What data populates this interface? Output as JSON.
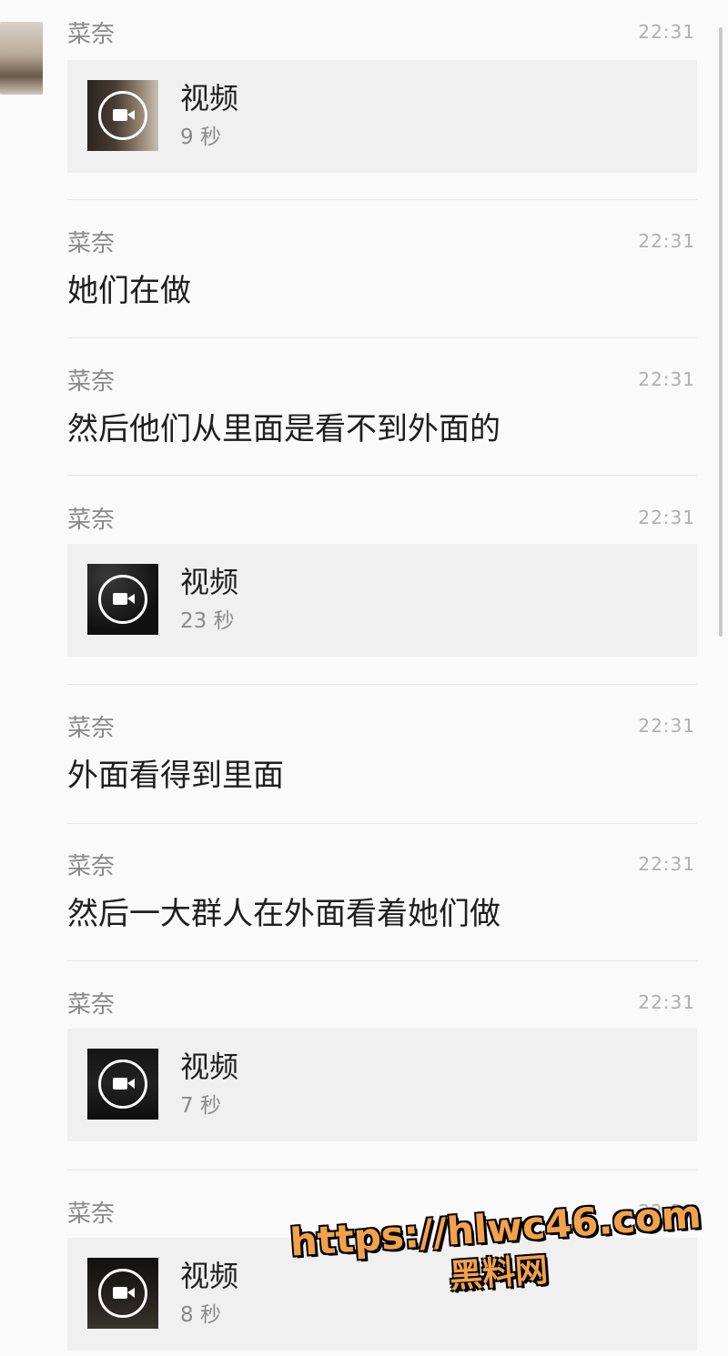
{
  "messages": [
    {
      "type": "video",
      "sender": "菜奈",
      "time": "22:31",
      "title": "视频",
      "duration": "9 秒"
    },
    {
      "type": "text",
      "sender": "菜奈",
      "time": "22:31",
      "text": "她们在做"
    },
    {
      "type": "text",
      "sender": "菜奈",
      "time": "22:31",
      "text": "然后他们从里面是看不到外面的"
    },
    {
      "type": "video",
      "sender": "菜奈",
      "time": "22:31",
      "title": "视频",
      "duration": "23 秒"
    },
    {
      "type": "text",
      "sender": "菜奈",
      "time": "22:31",
      "text": "外面看得到里面"
    },
    {
      "type": "text",
      "sender": "菜奈",
      "time": "22:31",
      "text": "然后一大群人在外面看着她们做"
    },
    {
      "type": "video",
      "sender": "菜奈",
      "time": "22:31",
      "title": "视频",
      "duration": "7 秒"
    },
    {
      "type": "video",
      "sender": "菜奈",
      "time": "22:31",
      "title": "视频",
      "duration": "8 秒"
    }
  ],
  "watermark": {
    "url": "https://hlwc46.com",
    "name": "黑料网"
  }
}
